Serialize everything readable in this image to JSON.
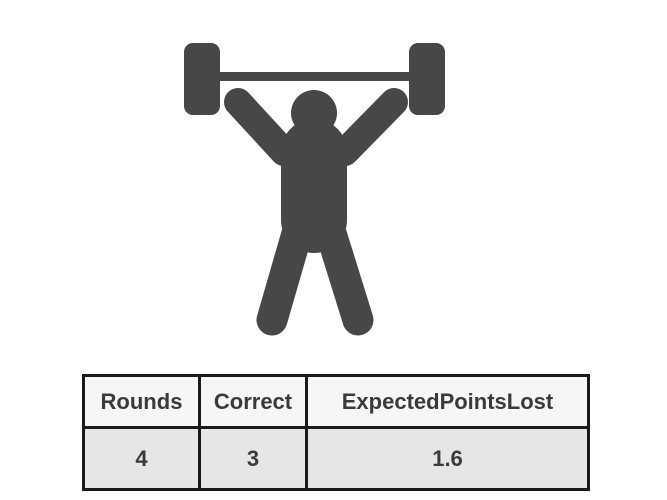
{
  "icon": "weightlifter-icon",
  "icon_color": "#474747",
  "table": {
    "headers": [
      "Rounds",
      "Correct",
      "ExpectedPointsLost"
    ],
    "row": [
      "4",
      "3",
      "1.6"
    ]
  }
}
